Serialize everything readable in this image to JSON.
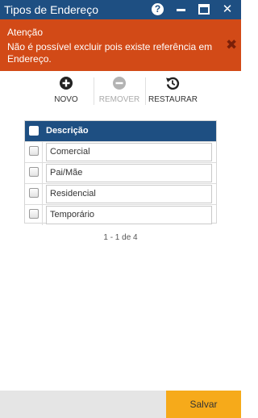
{
  "window": {
    "title": "Tipos de Endereço",
    "help_glyph": "?",
    "close_glyph": "✕"
  },
  "alert": {
    "title": "Atenção",
    "message": "Não é possível excluir pois existe referência em Endereço.",
    "close_glyph": "✖",
    "color": "#d24a17"
  },
  "toolbar": {
    "novo": {
      "label": "NOVO",
      "icon": "plus-circle-icon"
    },
    "remover": {
      "label": "REMOVER",
      "icon": "minus-circle-icon",
      "disabled": true
    },
    "restaurar": {
      "label": "RESTAURAR",
      "icon": "restore-icon"
    }
  },
  "grid": {
    "header": "Descrição",
    "rows": [
      {
        "value": "Comercial"
      },
      {
        "value": "Pai/Mãe"
      },
      {
        "value": "Residencial"
      },
      {
        "value": "Temporário"
      }
    ]
  },
  "pager": {
    "text": "1 - 1 de 4"
  },
  "footer": {
    "save_label": "Salvar",
    "accent": "#f6aa1a"
  },
  "colors": {
    "header_bg": "#1e4f82"
  }
}
